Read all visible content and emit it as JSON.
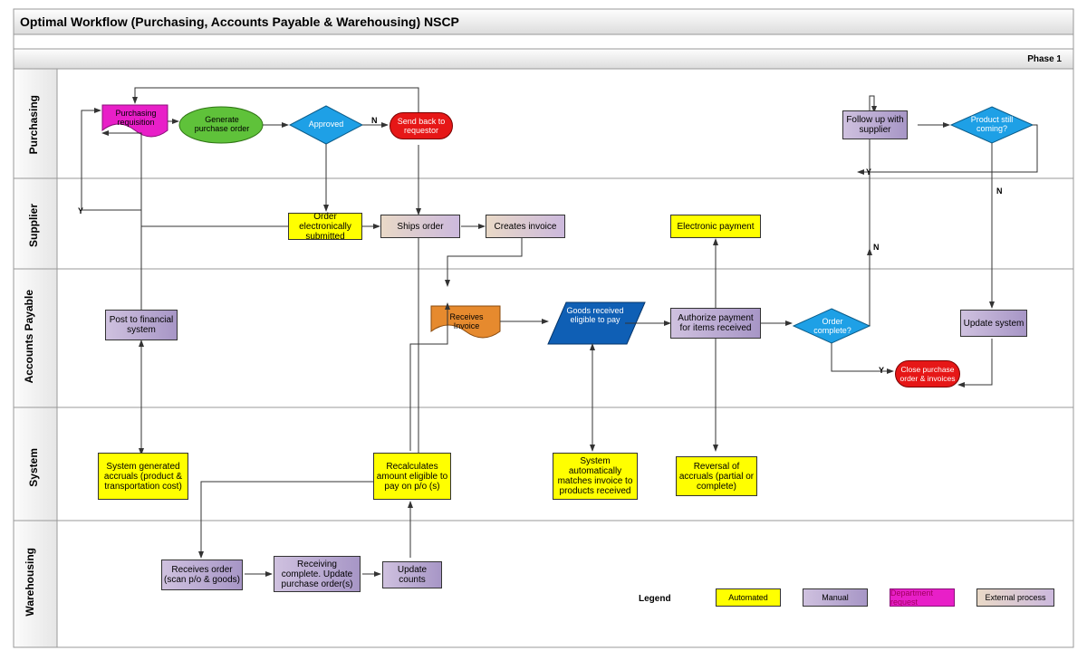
{
  "title": "Optimal Workflow (Purchasing, Accounts Payable & Warehousing) NSCP",
  "phase": "Phase 1",
  "lanes": {
    "purchasing": "Purchasing",
    "supplier": "Supplier",
    "ap": "Accounts Payable",
    "system": "System",
    "warehousing": "Warehousing"
  },
  "purchasing": {
    "req": "Purchasing requisition",
    "gen_po": "Generate purchase order",
    "approved": "Approved",
    "send_back": "Send back to requestor",
    "follow_up": "Follow up with supplier",
    "still_coming": "Product still coming?"
  },
  "supplier": {
    "submitted": "Order electronically submitted",
    "ships": "Ships order",
    "creates_inv": "Creates invoice",
    "epayment": "Electronic payment"
  },
  "ap": {
    "post_fin": "Post to financial system",
    "recv_inv": "Receives Invoice",
    "goods_elig": "Goods received eligible to pay",
    "auth_pay": "Authorize payment for items received",
    "order_complete": "Order complete?",
    "close_po": "Close purchase order & invoices",
    "update_sys": "Update system"
  },
  "system": {
    "accruals": "System generated accruals (product & transportation cost)",
    "recalc": "Recalculates amount eligible to pay on p/o (s)",
    "match": "System automatically matches invoice to products received",
    "reversal": "Reversal of accruals (partial or complete)"
  },
  "wh": {
    "recv_order": "Receives order (scan p/o & goods)",
    "recv_complete": "Receiving complete. Update purchase order(s)",
    "update_counts": "Update counts"
  },
  "legend": {
    "title": "Legend",
    "automated": "Automated",
    "manual": "Manual",
    "dept_req": "Department request",
    "external": "External process"
  },
  "labels": {
    "Y": "Y",
    "N": "N"
  },
  "chart_data": {
    "type": "diagram",
    "diagram_type": "cross-functional-flowchart",
    "title": "Optimal Workflow (Purchasing, Accounts Payable & Warehousing) NSCP",
    "phase": "Phase 1",
    "swimlanes": [
      "Purchasing",
      "Supplier",
      "Accounts Payable",
      "System",
      "Warehousing"
    ],
    "node_types": {
      "automated": "yellow rectangle / system step",
      "manual": "purple rectangle / human step",
      "external": "tan-lavender gradient rectangle / external actor step",
      "decision": "diamond",
      "terminator": "red rounded rectangle",
      "document": "document shape (wavy bottom)",
      "data": "parallelogram"
    },
    "nodes": [
      {
        "id": "req",
        "lane": "Purchasing",
        "label": "Purchasing requisition",
        "type": "document",
        "color": "magenta"
      },
      {
        "id": "gen_po",
        "lane": "Purchasing",
        "label": "Generate purchase order",
        "type": "automated",
        "color": "green"
      },
      {
        "id": "approved",
        "lane": "Purchasing",
        "label": "Approved",
        "type": "decision",
        "color": "blue"
      },
      {
        "id": "send_back",
        "lane": "Purchasing",
        "label": "Send back to requestor",
        "type": "terminator",
        "color": "red"
      },
      {
        "id": "follow_up",
        "lane": "Purchasing",
        "label": "Follow up with supplier",
        "type": "manual"
      },
      {
        "id": "still_coming",
        "lane": "Purchasing",
        "label": "Product still coming?",
        "type": "decision",
        "color": "blue"
      },
      {
        "id": "submitted",
        "lane": "Supplier",
        "label": "Order electronically submitted",
        "type": "automated"
      },
      {
        "id": "ships",
        "lane": "Supplier",
        "label": "Ships order",
        "type": "external"
      },
      {
        "id": "creates_inv",
        "lane": "Supplier",
        "label": "Creates invoice",
        "type": "external"
      },
      {
        "id": "epayment",
        "lane": "Supplier",
        "label": "Electronic payment",
        "type": "automated"
      },
      {
        "id": "post_fin",
        "lane": "Accounts Payable",
        "label": "Post to financial system",
        "type": "manual"
      },
      {
        "id": "recv_inv",
        "lane": "Accounts Payable",
        "label": "Receives Invoice",
        "type": "document",
        "color": "orange"
      },
      {
        "id": "goods_elig",
        "lane": "Accounts Payable",
        "label": "Goods received eligible to pay",
        "type": "data",
        "color": "darkblue"
      },
      {
        "id": "auth_pay",
        "lane": "Accounts Payable",
        "label": "Authorize payment for items received",
        "type": "manual"
      },
      {
        "id": "order_complete",
        "lane": "Accounts Payable",
        "label": "Order complete?",
        "type": "decision",
        "color": "blue"
      },
      {
        "id": "close_po",
        "lane": "Accounts Payable",
        "label": "Close purchase order & invoices",
        "type": "terminator",
        "color": "red"
      },
      {
        "id": "update_sys",
        "lane": "Accounts Payable",
        "label": "Update system",
        "type": "manual"
      },
      {
        "id": "accruals",
        "lane": "System",
        "label": "System generated accruals (product & transportation cost)",
        "type": "automated"
      },
      {
        "id": "recalc",
        "lane": "System",
        "label": "Recalculates amount eligible to pay on p/o (s)",
        "type": "automated"
      },
      {
        "id": "match",
        "lane": "System",
        "label": "System automatically matches invoice to products received",
        "type": "automated"
      },
      {
        "id": "reversal",
        "lane": "System",
        "label": "Reversal of accruals (partial or complete)",
        "type": "automated"
      },
      {
        "id": "recv_order",
        "lane": "Warehousing",
        "label": "Receives order (scan p/o & goods)",
        "type": "manual"
      },
      {
        "id": "recv_complete",
        "lane": "Warehousing",
        "label": "Receiving complete. Update purchase order(s)",
        "type": "manual"
      },
      {
        "id": "update_counts",
        "lane": "Warehousing",
        "label": "Update counts",
        "type": "manual"
      }
    ],
    "edges": [
      {
        "from": "req",
        "to": "gen_po"
      },
      {
        "from": "gen_po",
        "to": "approved"
      },
      {
        "from": "approved",
        "to": "send_back",
        "label": "N"
      },
      {
        "from": "send_back",
        "to": "req",
        "note": "loops back to requisition"
      },
      {
        "from": "approved",
        "to": "submitted",
        "label": "Y (implicit)"
      },
      {
        "from": "submitted",
        "to": "ships"
      },
      {
        "from": "ships",
        "to": "creates_inv"
      },
      {
        "from": "submitted",
        "to": "accruals"
      },
      {
        "from": "ships",
        "to": "recv_order",
        "note": "via vertical drop"
      },
      {
        "from": "creates_inv",
        "to": "recv_inv"
      },
      {
        "from": "recv_inv",
        "to": "match"
      },
      {
        "from": "recv_order",
        "to": "recv_complete"
      },
      {
        "from": "recv_complete",
        "to": "update_counts"
      },
      {
        "from": "update_counts",
        "to": "recalc"
      },
      {
        "from": "recalc",
        "to": "recv_inv",
        "note": "merges into invoice/receiving path"
      },
      {
        "from": "match",
        "to": "goods_elig"
      },
      {
        "from": "goods_elig",
        "to": "auth_pay"
      },
      {
        "from": "auth_pay",
        "to": "reversal"
      },
      {
        "from": "auth_pay",
        "to": "epayment"
      },
      {
        "from": "auth_pay",
        "to": "order_complete"
      },
      {
        "from": "order_complete",
        "to": "close_po",
        "label": "Y"
      },
      {
        "from": "order_complete",
        "to": "follow_up",
        "label": "N"
      },
      {
        "from": "follow_up",
        "to": "still_coming"
      },
      {
        "from": "still_coming",
        "to": "ships/flow",
        "label": "Y",
        "note": "returns to supplier flow"
      },
      {
        "from": "still_coming",
        "to": "update_sys",
        "label": "N"
      },
      {
        "from": "update_sys",
        "to": "close_po"
      },
      {
        "from": "accruals",
        "to": "post_fin"
      },
      {
        "from": "post_fin",
        "to": "req",
        "label": "Y",
        "note": "loop upstream"
      }
    ],
    "legend": [
      {
        "label": "Automated",
        "style": "yellow fill"
      },
      {
        "label": "Manual",
        "style": "purple gradient fill"
      },
      {
        "label": "Department request",
        "style": "magenta"
      },
      {
        "label": "External process",
        "style": "tan-lavender gradient"
      }
    ]
  }
}
